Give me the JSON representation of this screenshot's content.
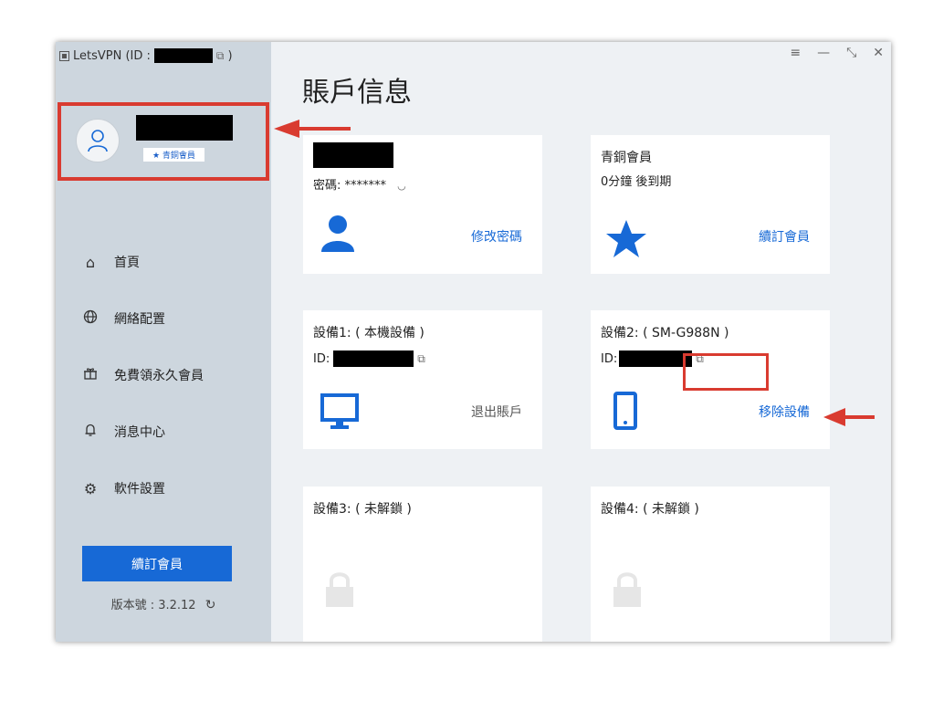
{
  "titlebar": {
    "app_name": "LetsVPN (ID :",
    "close_paren": ")"
  },
  "window_controls": {
    "menu": "≡",
    "minimize": "—",
    "restore": "⤡",
    "close": "✕"
  },
  "profile": {
    "badge": "★ 青銅會員"
  },
  "nav": {
    "items": [
      {
        "label": "首頁",
        "icon": "home-icon"
      },
      {
        "label": "網絡配置",
        "icon": "globe-icon"
      },
      {
        "label": "免費領永久會員",
        "icon": "gift-icon"
      },
      {
        "label": "消息中心",
        "icon": "bell-icon"
      },
      {
        "label": "軟件設置",
        "icon": "gear-icon"
      }
    ]
  },
  "sidebar_footer": {
    "renew_label": "續訂會員",
    "version_label": "版本號 : 3.2.12"
  },
  "page_title": "賬戶信息",
  "cards": {
    "account": {
      "password_label": "密碼: *******",
      "action": "修改密碼"
    },
    "membership": {
      "title": "青銅會員",
      "expiry": "0分鐘 後到期",
      "action": "續訂會員"
    },
    "device1": {
      "title": "設備1: ( 本機設備 )",
      "id_label": "ID:",
      "action": "退出賬戶"
    },
    "device2": {
      "title": "設備2: ( SM-G988N )",
      "id_label": "ID:",
      "action": "移除設備"
    },
    "device3": {
      "title": "設備3: ( 未解鎖 )"
    },
    "device4": {
      "title": "設備4: ( 未解鎖 )"
    }
  },
  "colors": {
    "accent": "#1769d6",
    "annotation": "#d93b30",
    "sidebar": "#cdd6de"
  }
}
